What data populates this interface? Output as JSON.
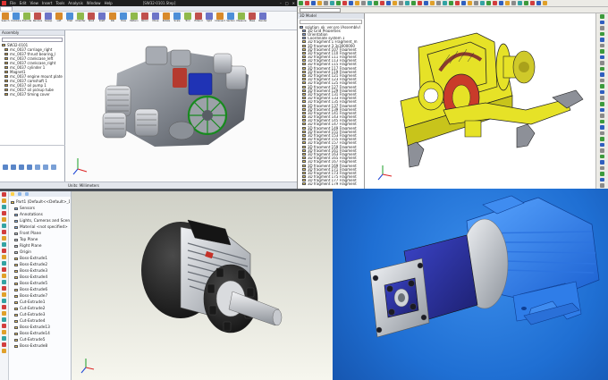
{
  "q1": {
    "title": "[SW32-0101.Step]",
    "menus": [
      "File",
      "Edit",
      "View",
      "Insert",
      "Tools",
      "Analysis",
      "Window",
      "Help"
    ],
    "ribbon_labels": [
      "Search",
      "Combine",
      "Extrude",
      "Revolve",
      "Sweep",
      "Loft",
      "Fillet",
      "Chamfer",
      "Shell",
      "Draft",
      "Rib",
      "Hole",
      "Pattern",
      "Mirror",
      "Move",
      "Rotate",
      "Scale",
      "Trim",
      "Extend",
      "Split",
      "Intersect",
      "Section",
      "Measure",
      "Mass",
      "Render"
    ],
    "panel_header": "Assembly",
    "tree_items": [
      "SW32-0101",
      "mc_0037 carriage_right",
      "mc_0037 thrust bearing_l",
      "mc_0037 crankcase_left",
      "mc_0037 crankcase_right",
      "mc_0037 cylinder 1",
      "Magnet1",
      "mc_0037 engine mount plate",
      "mc_0037 camshaft 1",
      "mc_0037 oil pump 1",
      "mc_0037 oil pickup tube",
      "mc_0037 timing cover"
    ],
    "status": "Units: Millimeters"
  },
  "q2": {
    "title": "3D Model",
    "search_placeholder": "Search",
    "tree_items": [
      "solution_ok_ver.pro (Assembly)",
      "3D Grid Properties",
      "Orientation",
      "Coordinate system 1",
      "3D fragment 1 Fragment_m",
      "3D fragment 3 3s3000000",
      "3D fragment 107 Fragment",
      "3D fragment 110 Fragment",
      "3D fragment 111 Fragment",
      "3D fragment 113 Fragment",
      "3D fragment 115 Fragment",
      "3D fragment 117 Fragment",
      "3D fragment 119 Fragment",
      "3D fragment 121 Fragment",
      "3D fragment 123 Fragment",
      "3D fragment 125 Fragment",
      "3D fragment 127 Fragment",
      "3D fragment 129 Fragment",
      "3D fragment 131 Fragment",
      "3D fragment 133 Fragment",
      "3D fragment 135 Fragment",
      "3D fragment 137 Fragment",
      "3D fragment 139 Fragment",
      "3D fragment 141 Fragment",
      "3D fragment 143 Fragment",
      "3D fragment 145 Fragment",
      "3D fragment 147 Fragment",
      "3D fragment 149 Fragment",
      "3D fragment 151 Fragment",
      "3D fragment 153 Fragment",
      "3D fragment 155 Fragment",
      "3D fragment 157 Fragment",
      "3D fragment 159 Fragment",
      "3D fragment 161 Fragment",
      "3D fragment 163 Fragment",
      "3D fragment 165 Fragment",
      "3D fragment 167 Fragment",
      "3D fragment 169 Fragment",
      "3D fragment 171 Fragment",
      "3D fragment 173 Fragment",
      "3D fragment 175 Fragment",
      "3D fragment 177 Fragment",
      "3D fragment 179 Fragment"
    ]
  },
  "q3": {
    "title": "Part1 (Default<<Default>_Display State 1>)",
    "tree_items": [
      "Part1 (Default<<Default>_Di",
      "Sensors",
      "Annotations",
      "Lights, Cameras and Scene",
      "Material <not specified>",
      "Front Plane",
      "Top Plane",
      "Right Plane",
      "Origin",
      "Boss-Extrude1",
      "Boss-Extrude2",
      "Boss-Extrude3",
      "Boss-Extrude4",
      "Boss-Extrude5",
      "Boss-Extrude6",
      "Boss-Extrude7",
      "Cut-Extrude1",
      "Cut-Extrude2",
      "Cut-Extrude3",
      "Cut-Extrude4",
      "Boss-Extrude13",
      "Boss-Extrude14",
      "Cut-Extrude5",
      "Boss-Extrude8"
    ]
  },
  "colors": {
    "yellow": "#e6e227",
    "blue_bg": "#1f6fd3",
    "pump_blue": "#2a2f9a",
    "steel": "#c7ccd3"
  }
}
